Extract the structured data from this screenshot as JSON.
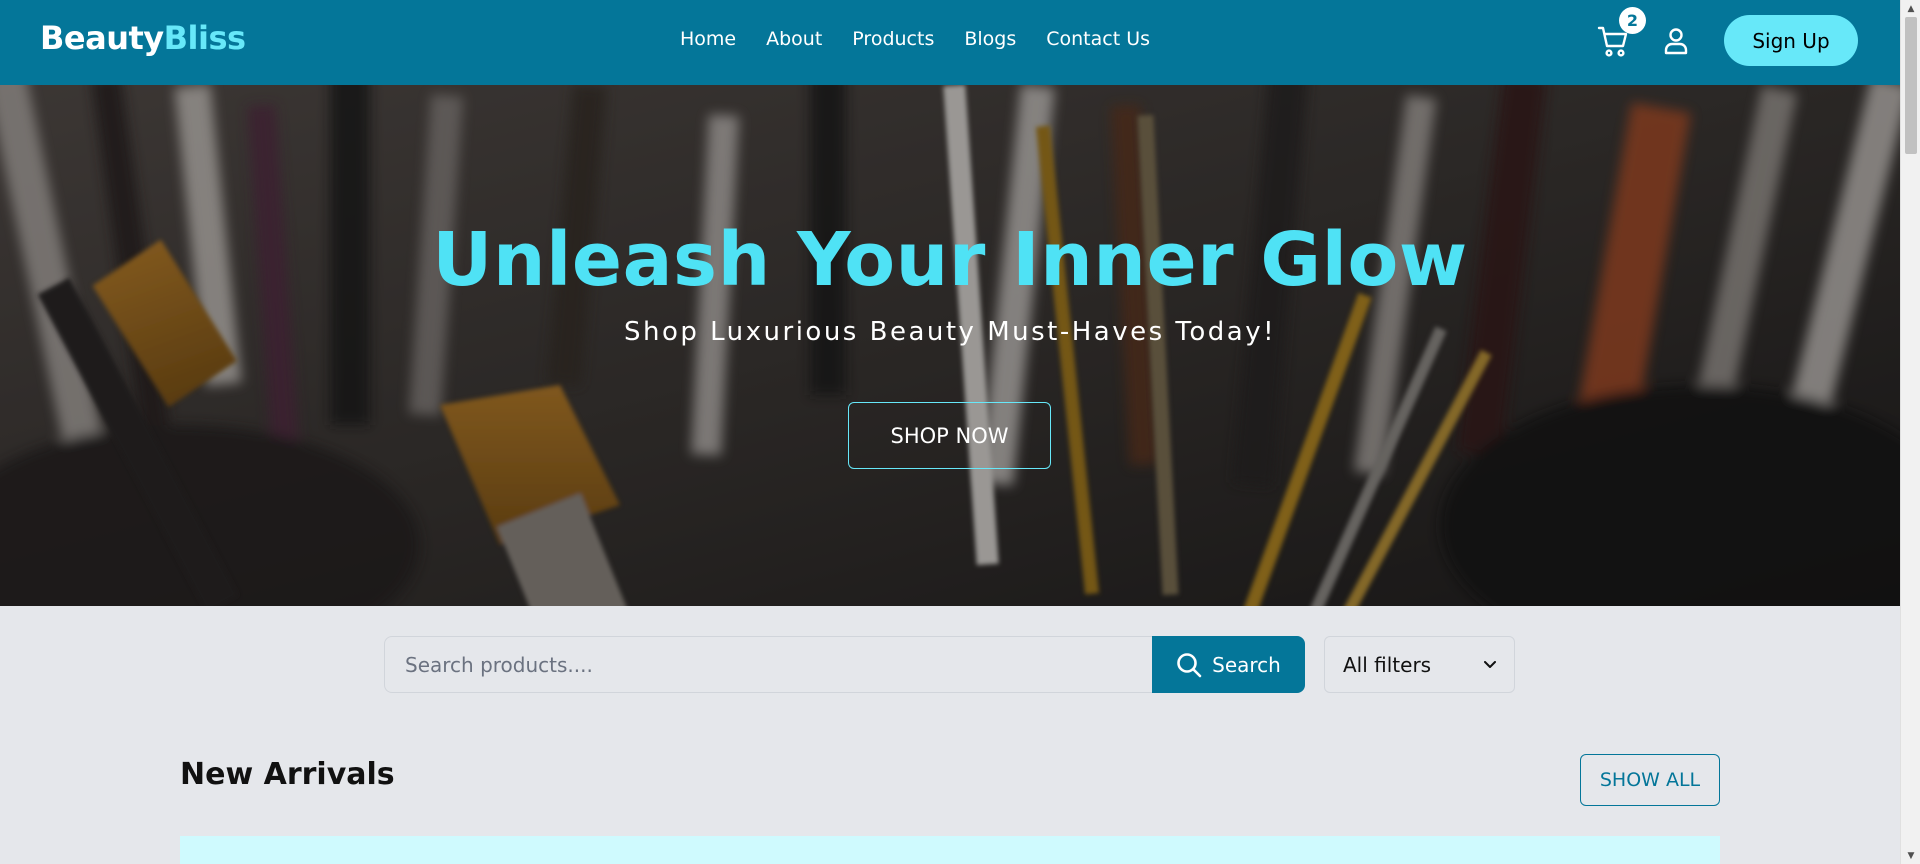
{
  "header": {
    "brand_part1": "Beauty",
    "brand_part2": "Bliss",
    "nav": [
      "Home",
      "About",
      "Products",
      "Blogs",
      "Contact Us"
    ],
    "cart_count": "2",
    "signup_label": "Sign Up"
  },
  "hero": {
    "title": "Unleash Your Inner Glow",
    "subtitle": "Shop Luxurious Beauty Must-Haves Today!",
    "cta_label": "SHOP NOW"
  },
  "search": {
    "placeholder": "Search products....",
    "button_label": "Search",
    "filter_selected": "All filters"
  },
  "new_arrivals": {
    "title": "New Arrivals",
    "show_all_label": "SHOW ALL"
  },
  "colors": {
    "primary": "#047699",
    "accent": "#67e8f9",
    "page_bg": "#e5e7eb",
    "panel_bg": "#cffafe"
  },
  "icons": {
    "cart": "cart-icon",
    "user": "user-icon",
    "search": "search-icon",
    "dropdown": "chevron-down-icon"
  }
}
